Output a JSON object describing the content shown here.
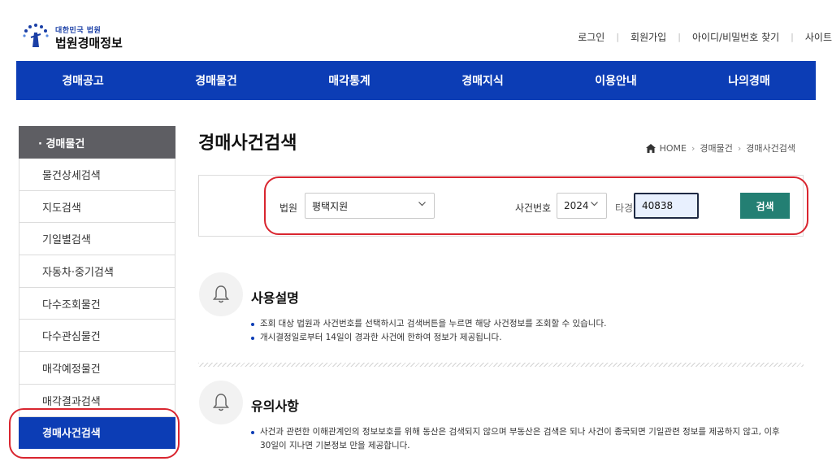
{
  "logo": {
    "small": "대한민국 법원",
    "big": "법원경매정보"
  },
  "util_links": [
    "로그인",
    "회원가입",
    "아이디/비밀번호 찾기",
    "사이트"
  ],
  "gnb": [
    "경매공고",
    "경매물건",
    "매각통계",
    "경매지식",
    "이용안내",
    "나의경매"
  ],
  "sidebar": {
    "header": "· 경매물건",
    "items": [
      "물건상세검색",
      "지도검색",
      "기일별검색",
      "자동차·중기검색",
      "다수조회물건",
      "다수관심물건",
      "매각예정물건",
      "매각결과검색",
      "경매사건검색"
    ],
    "active_index": 8
  },
  "page_title": "경매사건검색",
  "breadcrumb": [
    "HOME",
    "경매물건",
    "경매사건검색"
  ],
  "search": {
    "court_label": "법원",
    "court_value": "평택지원",
    "case_label": "사건번호",
    "year_value": "2024",
    "case_type": "타경",
    "case_number": "40838",
    "button": "검색"
  },
  "usage": {
    "title": "사용설명",
    "items": [
      "조회 대상 법원과 사건번호를 선택하시고 검색버튼을 누르면 해당 사건정보를 조회할 수 있습니다.",
      "개시결정일로부터 14일이 경과한 사건에 한하여 정보가 제공됩니다."
    ]
  },
  "notice": {
    "title": "유의사항",
    "line1": "사건과 관련한 이해관계인의 정보보호를 위해 동산은 검색되지 않으며 부동산은 검색은 되나 사건이 종국되면 기일관련 정보를 제공하지 않고, 이후",
    "line2": "30일이 지나면 기본정보 만을 제공합니다."
  },
  "colors": {
    "brand_blue": "#0c3db5",
    "search_green": "#237f73",
    "highlight_red": "#d9252f",
    "sidebar_header": "#5e5e63"
  }
}
